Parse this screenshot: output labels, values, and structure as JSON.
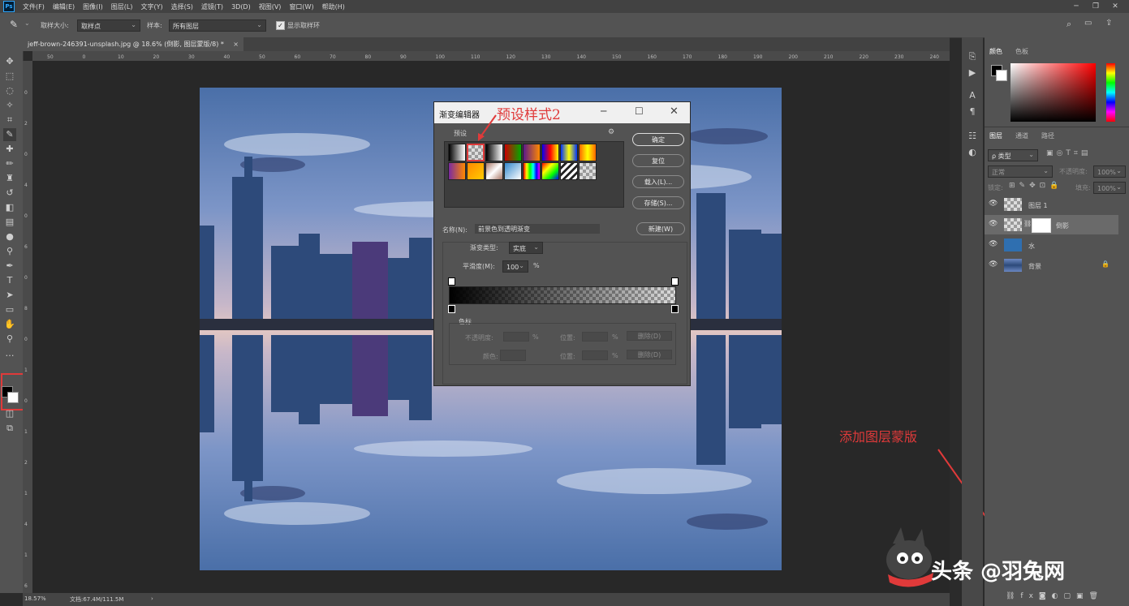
{
  "menu": [
    "文件(F)",
    "编辑(E)",
    "图像(I)",
    "图层(L)",
    "文字(Y)",
    "选择(S)",
    "滤镜(T)",
    "3D(D)",
    "视图(V)",
    "窗口(W)",
    "帮助(H)"
  ],
  "app_logo": "Ps",
  "options": {
    "sample_size_label": "取样大小:",
    "sample_size_value": "取样点",
    "sample_label": "样本:",
    "sample_value": "所有图层",
    "show_ring_label": "显示取样环"
  },
  "document": {
    "tab_title": "jeff-brown-246391-unsplash.jpg @ 18.6% (倒影, 图层蒙版/8) *",
    "zoom": "18.57%",
    "doc_info": "文档:67.4M/111.5M"
  },
  "ruler": {
    "h_ticks": [
      "50",
      "0",
      "10",
      "20",
      "30",
      "40",
      "50",
      "60",
      "70",
      "80",
      "90",
      "100",
      "110",
      "120",
      "130",
      "140",
      "150",
      "160",
      "170",
      "180",
      "190",
      "200",
      "210",
      "220",
      "230",
      "240",
      "25"
    ],
    "v_ticks": [
      "0",
      "2",
      "0",
      "4",
      "0",
      "6",
      "0",
      "8",
      "0",
      "1",
      "0",
      "1",
      "2",
      "1",
      "4",
      "1",
      "6"
    ]
  },
  "dialog": {
    "title": "渐变编辑器",
    "presets_label": "预设",
    "ok": "确定",
    "reset": "复位",
    "load": "载入(L)...",
    "save": "存储(S)...",
    "name_label": "名称(N):",
    "name_value": "前景色到透明渐变",
    "new": "新建(W)",
    "type_label": "渐变类型:",
    "type_value": "实底",
    "smooth_label": "平滑度(M):",
    "smooth_value": "100",
    "smooth_unit": "%",
    "stops_label": "色标",
    "opacity_label": "不透明度:",
    "location_label": "位置:",
    "delete_label": "删除(D)",
    "color_label": "颜色:",
    "percent": "%"
  },
  "annotations": {
    "preset2": "预设样式2",
    "add_mask": "添加图层蒙版",
    "annotation_color": "#e03a3a"
  },
  "panels": {
    "color_tab": "颜色",
    "swatches_tab": "色板",
    "layers_tab": "图层",
    "channels_tab": "通道",
    "paths_tab": "路径",
    "kind_placeholder": "ρ 类型",
    "blend_mode": "正常",
    "opacity_label": "不透明度:",
    "opacity_value": "100%",
    "lock_label": "锁定:",
    "fill_label": "填充:",
    "fill_value": "100%",
    "layers": [
      {
        "name": "图层 1"
      },
      {
        "name": "倒影"
      },
      {
        "name": "水"
      },
      {
        "name": "背景"
      }
    ]
  },
  "watermark": "头条 @羽兔网"
}
